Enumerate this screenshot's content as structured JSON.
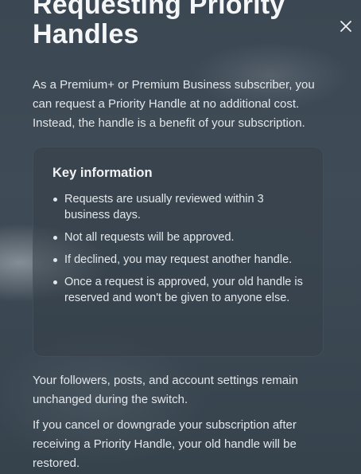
{
  "modal": {
    "title": "Requesting Priority Handles",
    "close_icon": "close-icon",
    "intro": "As a Premium+ or Premium Business subscriber, you can request a Priority Handle at no additional cost. Instead, the handle is a benefit of your subscription.",
    "key_info": {
      "heading": "Key information",
      "items": [
        "Requests are usually reviewed within 3 business days.",
        "Not all requests will be approved.",
        "If declined, you may request another handle.",
        "Once a request is approved, your old handle is reserved and won't be given to anyone else."
      ]
    },
    "paragraphs": [
      "Your followers, posts, and account settings remain unchanged during the switch.",
      "If you cancel or downgrade your subscription after receiving a Priority Handle, your old handle will be restored."
    ]
  },
  "colors": {
    "background": "#3f4b56",
    "text": "#e3e7ea",
    "card_background": "#343f48"
  }
}
